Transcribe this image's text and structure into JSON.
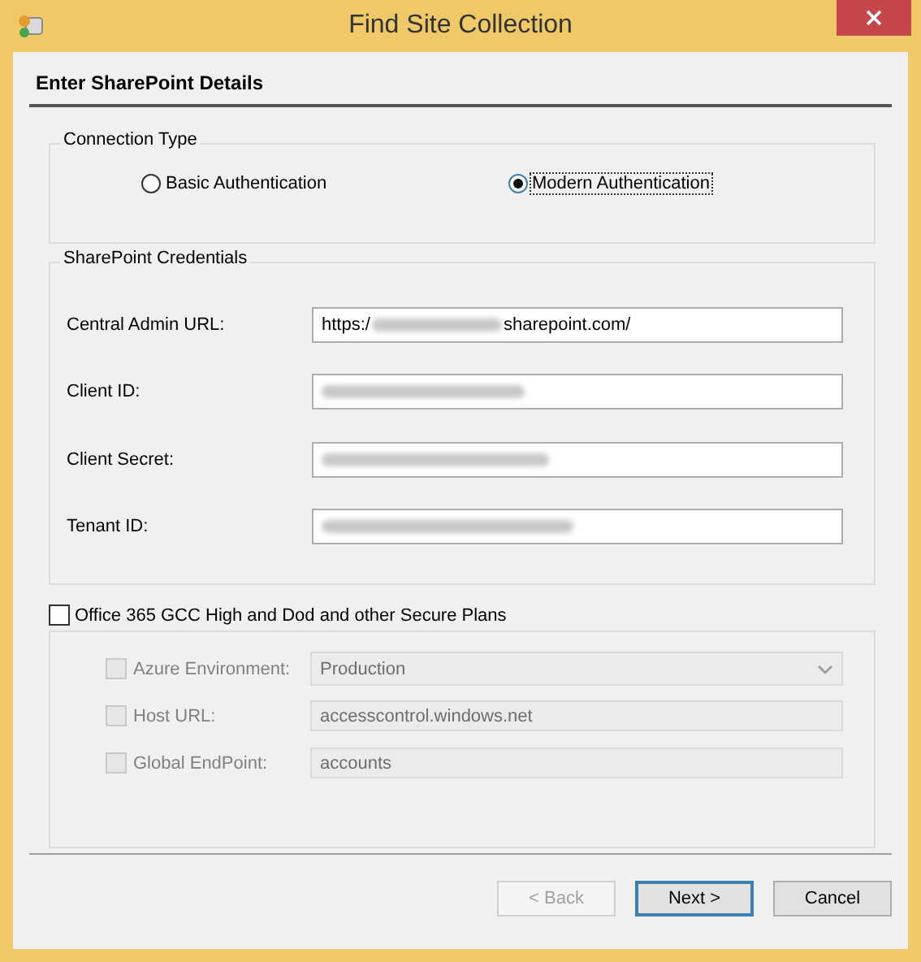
{
  "window": {
    "title": "Find Site Collection"
  },
  "header": "Enter SharePoint Details",
  "connection_type": {
    "legend": "Connection Type",
    "options": [
      {
        "label": "Basic Authentication",
        "selected": false,
        "focused": false
      },
      {
        "label": "Modern Authentication",
        "selected": true,
        "focused": true
      }
    ]
  },
  "credentials": {
    "legend": "SharePoint Credentials",
    "fields": [
      {
        "label": "Central Admin URL:",
        "value_start": "https:/",
        "value_redacted": true,
        "value_end": "sharepoint.com/"
      },
      {
        "label": "Client ID:",
        "placeholder_redacted": true
      },
      {
        "label": "Client Secret:",
        "placeholder_redacted": true
      },
      {
        "label": "Tenant ID:",
        "placeholder_redacted": true
      }
    ]
  },
  "secure_plans": {
    "label": "Office 365 GCC High and Dod and other Secure Plans",
    "checked": false,
    "rows": [
      {
        "kind": "dropdown",
        "label": "Azure Environment:",
        "value": "Production",
        "checked": false,
        "disabled": true
      },
      {
        "kind": "text",
        "label": "Host URL:",
        "value": "accesscontrol.windows.net",
        "checked": false,
        "disabled": true
      },
      {
        "kind": "text",
        "label": "Global EndPoint:",
        "value": "accounts",
        "checked": false,
        "disabled": true
      }
    ]
  },
  "buttons": [
    {
      "label": "< Back",
      "disabled": true,
      "default": false
    },
    {
      "label": "Next >",
      "disabled": false,
      "default": true
    },
    {
      "label": "Cancel",
      "disabled": false,
      "default": false
    }
  ]
}
